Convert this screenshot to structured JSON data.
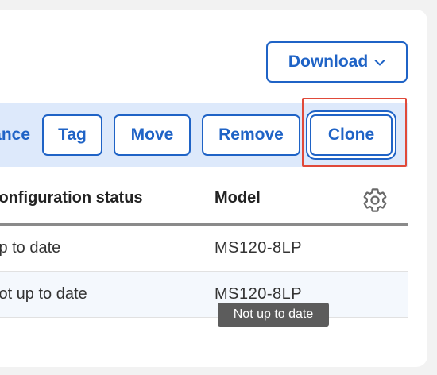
{
  "header": {
    "download_label": "Download",
    "download_icon": "chevron-down-icon"
  },
  "action_bar": {
    "cancel_label": "Cancel",
    "tag_label": "Tag",
    "move_label": "Move",
    "remove_label": "Remove",
    "clone_label": "Clone"
  },
  "table": {
    "columns": [
      "Configuration status",
      "Model"
    ],
    "settings_icon": "gear-icon",
    "rows": [
      {
        "status": "Up to date",
        "model": "MS120-8LP"
      },
      {
        "status": "Not up to date",
        "model": "MS120-8LP"
      }
    ]
  },
  "tooltip": {
    "text": "Not up to date"
  },
  "colors": {
    "accent": "#1f63c6",
    "action_bar_bg": "#dde9fb",
    "highlight": "#e04a3a",
    "tooltip_bg": "#5c5c5c"
  }
}
